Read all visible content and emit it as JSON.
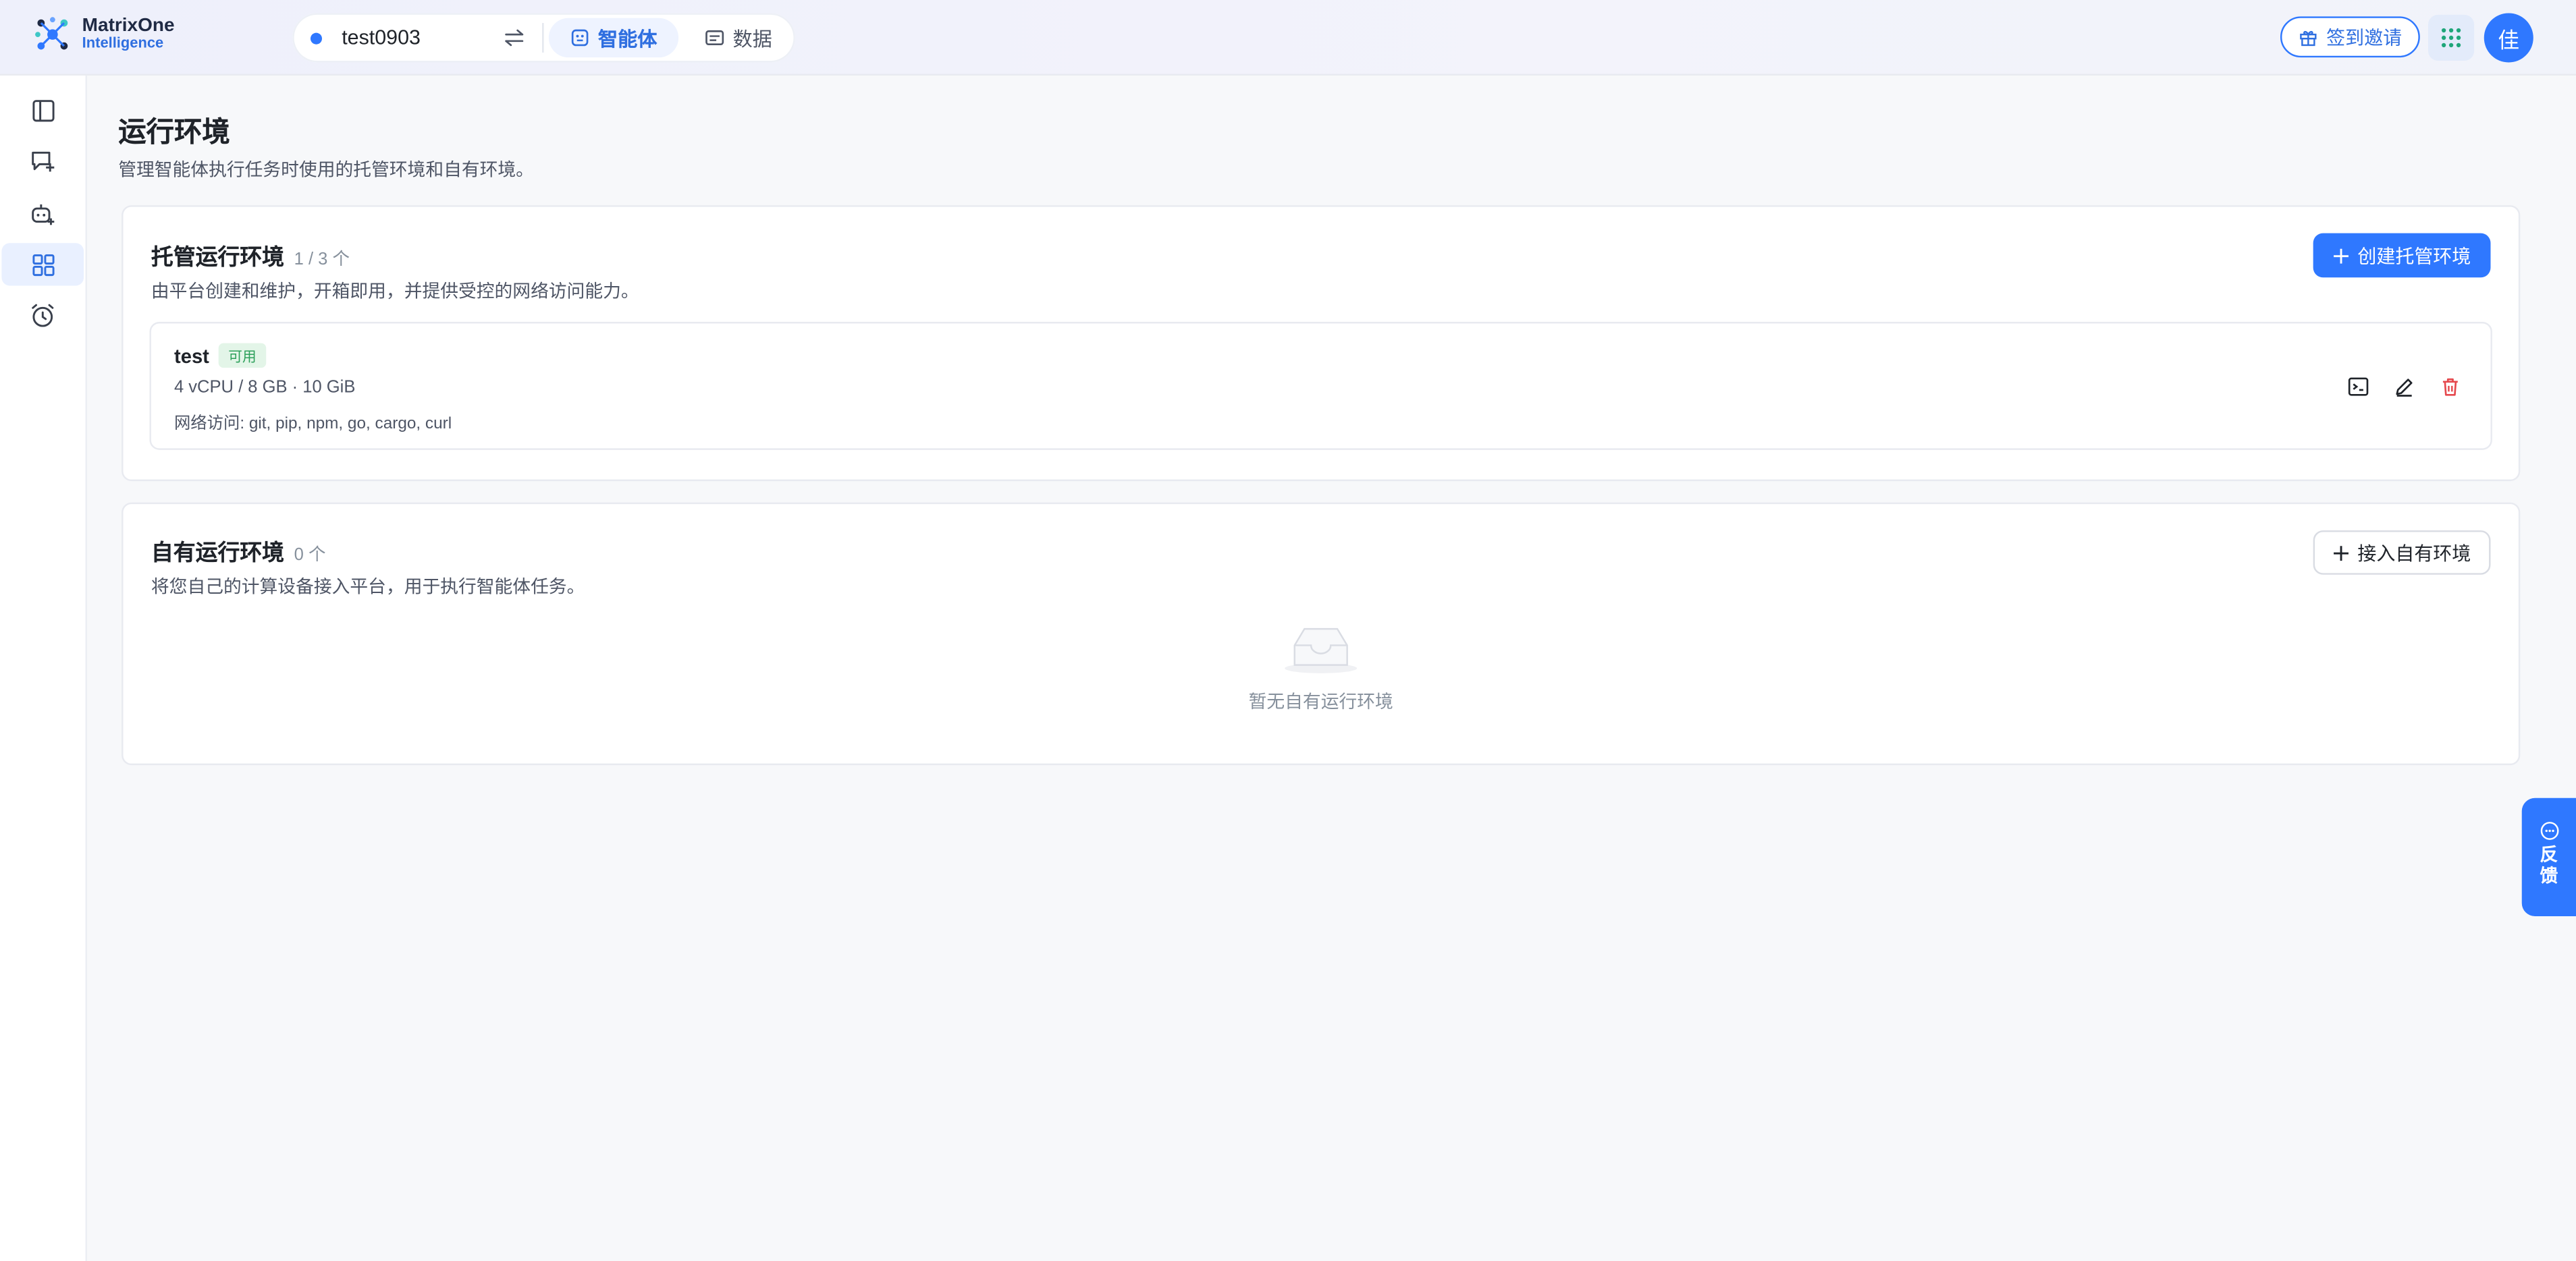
{
  "brand": {
    "name": "MatrixOne",
    "subtitle": "Intelligence"
  },
  "workspace": {
    "name": "test0903"
  },
  "nav_tabs": [
    {
      "label": "智能体",
      "active": true,
      "icon": "agent-icon"
    },
    {
      "label": "数据",
      "active": false,
      "icon": "data-icon"
    }
  ],
  "header": {
    "invite_label": "签到邀请",
    "avatar_initial": "佳"
  },
  "sidebar": {
    "items": [
      {
        "icon": "sidebar-toggle-icon",
        "active": false
      },
      {
        "icon": "new-chat-icon",
        "active": false
      },
      {
        "icon": "add-agent-icon",
        "active": false
      },
      {
        "icon": "grid-icon",
        "active": true
      },
      {
        "icon": "alarm-clock-icon",
        "active": false
      }
    ]
  },
  "page": {
    "title": "运行环境",
    "description": "管理智能体执行任务时使用的托管环境和自有环境。"
  },
  "managed": {
    "title": "托管运行环境",
    "count": "1 / 3 个",
    "description": "由平台创建和维护，开箱即用，并提供受控的网络访问能力。",
    "create_label": "创建托管环境",
    "items": [
      {
        "name": "test",
        "status": "可用",
        "spec": "4 vCPU / 8 GB · 10 GiB",
        "network": "网络访问: git, pip, npm, go, cargo, curl"
      }
    ]
  },
  "own": {
    "title": "自有运行环境",
    "count": "0 个",
    "description": "将您自己的计算设备接入平台，用于执行智能体任务。",
    "connect_label": "接入自有环境",
    "empty_text": "暂无自有运行环境"
  },
  "feedback": {
    "label": "反馈"
  },
  "colors": {
    "accent": "#2f78ff",
    "success": "#2ca05a",
    "danger": "#e5484d"
  }
}
